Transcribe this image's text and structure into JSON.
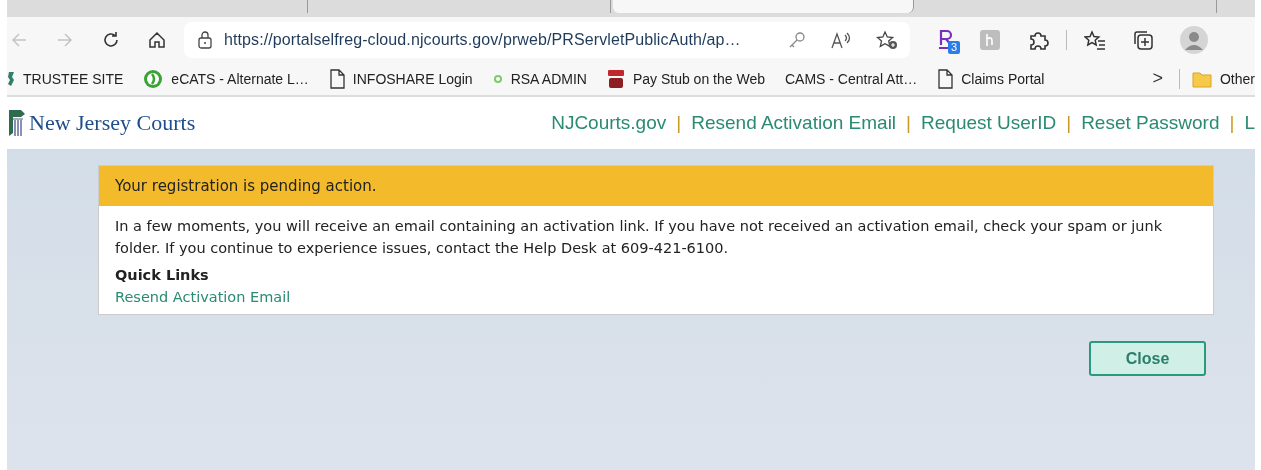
{
  "browser": {
    "tabs": [
      {
        "selected": false
      },
      {
        "selected": false
      },
      {
        "selected": true
      },
      {
        "selected": false
      }
    ],
    "toolbar": {
      "back": {
        "disabled": true
      },
      "forward": {
        "disabled": true
      },
      "address": "https://portalselfreg-cloud.njcourts.gov/prweb/PRServletPublicAuth/ap…",
      "extension_badge": "3"
    },
    "bookmarks": [
      {
        "label": "TRUSTEE SITE",
        "kind": "logo"
      },
      {
        "label": "eCATS - Alternate L…",
        "kind": "circle"
      },
      {
        "label": "INFOSHARE Login",
        "kind": "page"
      },
      {
        "label": "RSA ADMIN",
        "kind": "dot"
      },
      {
        "label": "Pay Stub on the Web",
        "kind": "badge"
      },
      {
        "label": "CAMS - Central Att…",
        "kind": "none"
      },
      {
        "label": "Claims Portal",
        "kind": "page"
      }
    ],
    "more_bookmarks": ">",
    "other_folder": "Other"
  },
  "site": {
    "logo_text": "New Jersey Courts",
    "nav": [
      {
        "label": "NJCourts.gov",
        "separator": "|"
      },
      {
        "label": "Resend Activation Email",
        "separator": "|"
      },
      {
        "label": "Request UserID",
        "separator": "|"
      },
      {
        "label": "Reset Password",
        "separator": "|"
      },
      {
        "label": "L"
      }
    ]
  },
  "notice": {
    "title": "Your registration is pending action.",
    "message": "In a few moments, you will receive an email containing an activation link. If you have not received an activation email, check your spam or junk folder. If you continue to experience issues, contact the Help Desk at 609-421-6100.",
    "quick_links_heading": "Quick Links",
    "quick_links": [
      "Resend Activation Email"
    ]
  },
  "buttons": [
    "Close"
  ]
}
